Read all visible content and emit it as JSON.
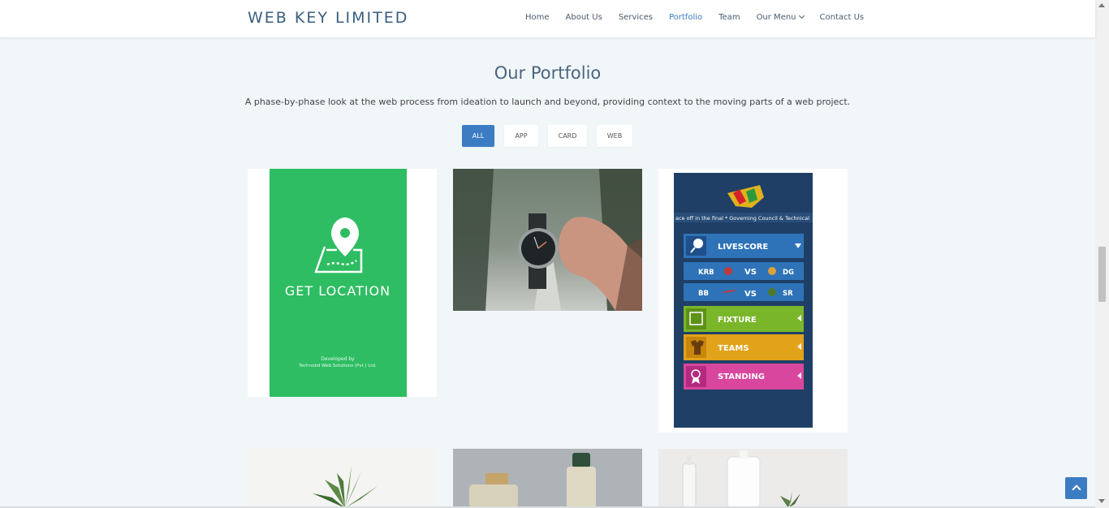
{
  "brand": {
    "name": "WEB KEY LIMITED"
  },
  "nav": {
    "items": [
      {
        "label": "Home",
        "active": false
      },
      {
        "label": "About Us",
        "active": false
      },
      {
        "label": "Services",
        "active": false
      },
      {
        "label": "Portfolio",
        "active": true
      },
      {
        "label": "Team",
        "active": false
      },
      {
        "label": "Our Menu",
        "active": false,
        "dropdown": true
      },
      {
        "label": "Contact Us",
        "active": false
      }
    ]
  },
  "portfolio": {
    "title": "Our Portfolio",
    "subtitle": "A phase-by-phase look at the web process from ideation to launch and beyond, providing context to the moving parts of a web project.",
    "filters": [
      {
        "label": "ALL",
        "active": true
      },
      {
        "label": "APP",
        "active": false
      },
      {
        "label": "CARD",
        "active": false
      },
      {
        "label": "WEB",
        "active": false
      }
    ],
    "items": [
      {
        "type": "app-screen-location",
        "text_main": "GET LOCATION",
        "text_credit_1": "Developed by",
        "text_credit_2": "Technobd Web Solutions (Pvt.) Ltd."
      },
      {
        "type": "photo-watch"
      },
      {
        "type": "app-screen-livescore",
        "ticker": "ace off in the final * Governing Council & Technical",
        "menu": {
          "livescore": "LIVESCORE",
          "match1_a": "KRB",
          "match1_vs": "VS",
          "match1_b": "DG",
          "match2_a": "BB",
          "match2_vs": "VS",
          "match2_b": "SR",
          "fixture": "FIXTURE",
          "teams": "TEAMS",
          "standing": "STANDING"
        }
      },
      {
        "type": "photo-succulent"
      },
      {
        "type": "photo-perfume"
      },
      {
        "type": "photo-bottles"
      }
    ]
  },
  "colors": {
    "accent": "#3c7cc3",
    "title": "#4a6580",
    "location_green": "#2ebd62",
    "livescore_navy": "#1f3f67",
    "fixture_green": "#7ab62a",
    "teams_orange": "#e2a21a",
    "standing_pink": "#d9469e"
  }
}
